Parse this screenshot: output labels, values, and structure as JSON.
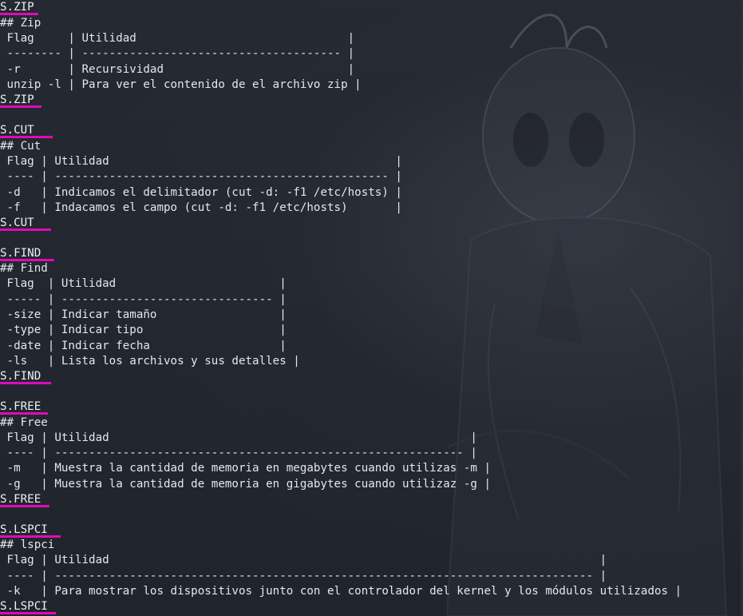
{
  "sections": [
    {
      "open_tag": "S.ZIP",
      "header": "## Zip",
      "rows": [
        " Flag     | Utilidad                               |",
        " -------- | -------------------------------------- |",
        " -r       | Recursividad                           |",
        " unzip -l | Para ver el contenido de el archivo zip |"
      ],
      "close_tag": "S.ZIP"
    },
    {
      "open_tag": "S.CUT",
      "header": "## Cut",
      "rows": [
        " Flag | Utilidad                                          |",
        " ---- | ------------------------------------------------- |",
        " -d   | Indicamos el delimitador (cut -d: -f1 /etc/hosts) |",
        " -f   | Indacamos el campo (cut -d: -f1 /etc/hosts)       |"
      ],
      "close_tag": "S.CUT"
    },
    {
      "open_tag": "S.FIND",
      "header": "## Find",
      "rows": [
        " Flag  | Utilidad                        |",
        " ----- | ------------------------------- |",
        " -size | Indicar tamaño                  |",
        " -type | Indicar tipo                    |",
        " -date | Indicar fecha                   |",
        " -ls   | Lista los archivos y sus detalles |"
      ],
      "close_tag": "S.FIND"
    },
    {
      "open_tag": "S.FREE",
      "header": "## Free",
      "rows": [
        " Flag | Utilidad                                                     |",
        " ---- | ------------------------------------------------------------ |",
        " -m   | Muestra la cantidad de memoria en megabytes cuando utilizas -m |",
        " -g   | Muestra la cantidad de memoria en gigabytes cuando utilizaz -g |"
      ],
      "close_tag": "S.FREE"
    },
    {
      "open_tag": "S.LSPCI",
      "header": "## lspci",
      "rows": [
        " Flag | Utilidad                                                                        |",
        " ---- | ------------------------------------------------------------------------------- |",
        " -k   | Para mostrar los dispositivos junto con el controlador del kernel y los módulos utilizados |"
      ],
      "close_tag": "S.LSPCI"
    }
  ],
  "colors": {
    "background": "#20242d",
    "text": "#e6e7ea",
    "tag_underline": "#e10ab9"
  }
}
